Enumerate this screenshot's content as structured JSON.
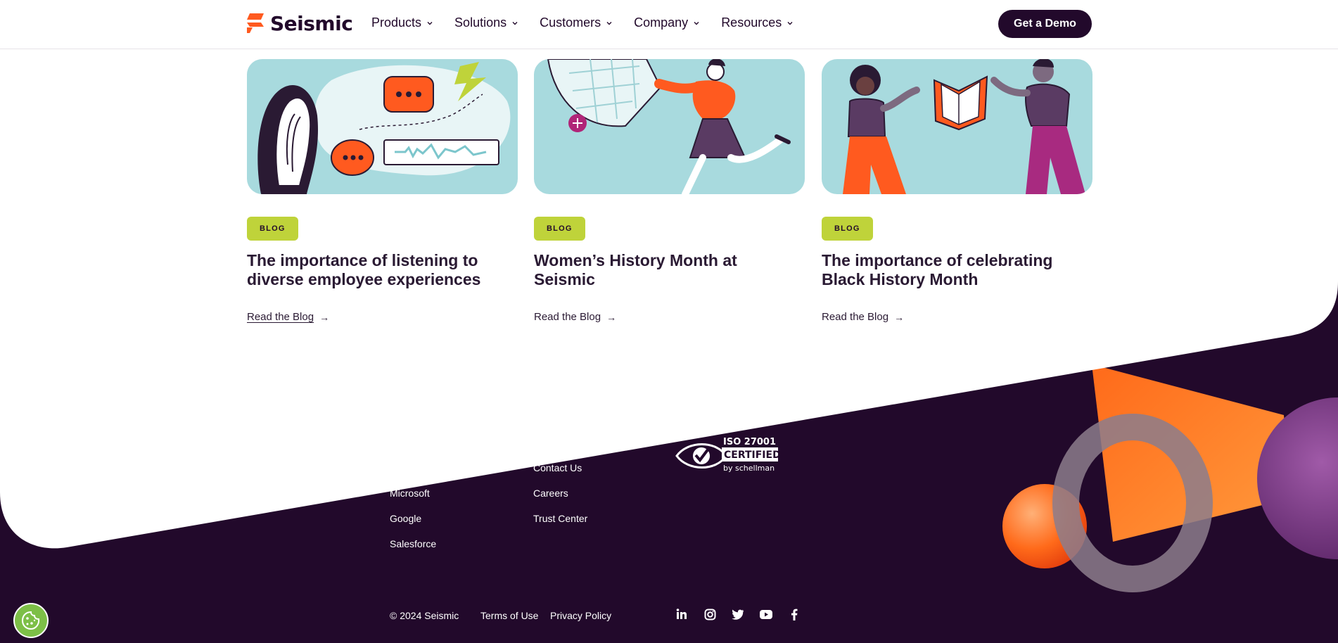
{
  "header": {
    "logo_text": "Seismic",
    "nav": [
      {
        "label": "Products"
      },
      {
        "label": "Solutions"
      },
      {
        "label": "Customers"
      },
      {
        "label": "Company"
      },
      {
        "label": "Resources"
      }
    ],
    "cta_label": "Get a Demo"
  },
  "cards": [
    {
      "badge": "BLOG",
      "title": "The importance of listening to diverse employee experiences",
      "link": "Read the Blog"
    },
    {
      "badge": "BLOG",
      "title": "Women’s History Month at Seismic",
      "link": "Read the Blog"
    },
    {
      "badge": "BLOG",
      "title": "The importance of celebrating Black History Month",
      "link": "Read the Blog"
    }
  ],
  "footer": {
    "partners": [
      "Microsoft",
      "Google",
      "Salesforce"
    ],
    "company": [
      "Contact Us",
      "Careers",
      "Trust Center"
    ],
    "certification": {
      "line1": "ISO 27001",
      "line2": "CERTIFIED",
      "line3": "by schellman"
    },
    "copyright": "© 2024 Seismic",
    "legal": [
      "Terms of Use",
      "Privacy Policy"
    ],
    "social_icons": [
      "linkedin-icon",
      "instagram-icon",
      "twitter-icon",
      "youtube-icon",
      "facebook-icon"
    ]
  },
  "colors": {
    "brand_dark": "#22092b",
    "brand_orange": "#ff5a1f",
    "badge_green": "#bfd33a",
    "card_teal": "#a8dade"
  }
}
